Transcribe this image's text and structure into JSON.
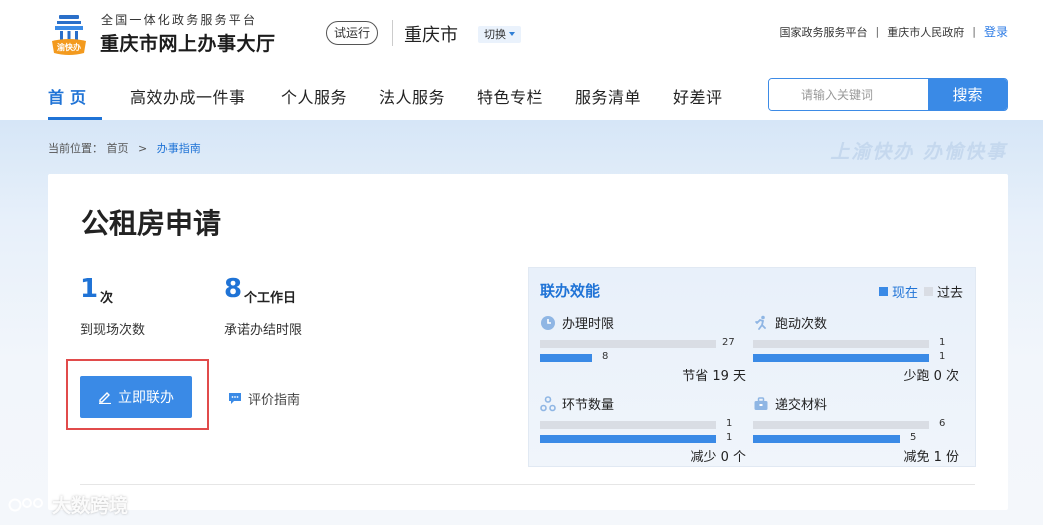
{
  "header": {
    "platform_sub": "全国一体化政务服务平台",
    "platform_name": "重庆市网上办事大厅",
    "logo_text": "渝快办",
    "trial_badge": "试运行",
    "city": "重庆市",
    "switch_label": "切换",
    "links": [
      "国家政务服务平台",
      "重庆市人民政府"
    ],
    "separator": "|",
    "login_label": "登录"
  },
  "nav": {
    "items": [
      "首页",
      "高效办成一件事",
      "个人服务",
      "法人服务",
      "特色专栏",
      "服务清单",
      "好差评"
    ],
    "active_index": 0
  },
  "search": {
    "placeholder": "请输入关键词",
    "button_label": "搜索"
  },
  "breadcrumb": {
    "prefix": "当前位置：",
    "home": "首页",
    "separator": ">",
    "current": "办事指南"
  },
  "slogan": "上渝快办  办愉快事",
  "service": {
    "title": "公租房申请",
    "visits_num": "1",
    "visits_unit": "次",
    "visits_label": "到现场次数",
    "days_num": "8",
    "days_unit": "个工作日",
    "days_label": "承诺办结时限",
    "apply_label": "立即联办",
    "evaluate_label": "评价指南"
  },
  "efficiency": {
    "title": "联办效能",
    "legend_now": "现在",
    "legend_past": "过去",
    "now_color": "#3a8ae6",
    "past_color": "#d9dde4",
    "stats": [
      {
        "label": "办理时限",
        "icon": "clock-icon",
        "past": 27,
        "now": 8,
        "past_label": "27",
        "now_label": "8",
        "foot": "节省 19 天"
      },
      {
        "label": "跑动次数",
        "icon": "runner-icon",
        "past": 1,
        "now": 1,
        "past_label": "1",
        "now_label": "1",
        "foot": "少跑 0 次"
      },
      {
        "label": "环节数量",
        "icon": "nodes-icon",
        "past": 1,
        "now": 1,
        "past_label": "1",
        "now_label": "1",
        "foot": "减少 0 个"
      },
      {
        "label": "递交材料",
        "icon": "briefcase-icon",
        "past": 6,
        "now": 5,
        "past_label": "6",
        "now_label": "5",
        "foot": "减免 1 份"
      }
    ]
  },
  "watermark": "大数跨境"
}
